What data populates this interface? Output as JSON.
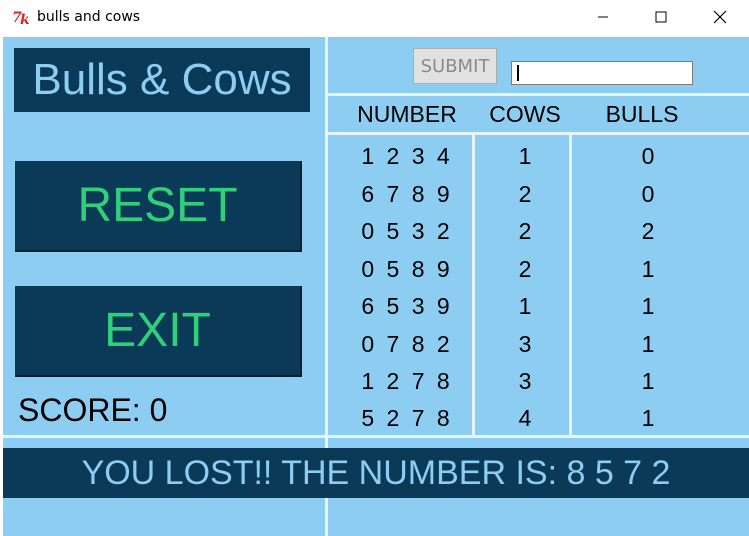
{
  "window": {
    "title": "bulls and cows",
    "icon": "tk-feather-icon",
    "controls": [
      "minimize-icon",
      "maximize-icon",
      "close-icon"
    ]
  },
  "game": {
    "title": "Bulls & Cows",
    "reset_label": "RESET",
    "exit_label": "EXIT",
    "score_label": "SCORE: 0",
    "submit_label": "SUBMIT",
    "guess_input_value": "",
    "status_message": "YOU LOST!! THE NUMBER IS: 8 5 7 2"
  },
  "table": {
    "headers": {
      "number": "NUMBER",
      "cows": "COWS",
      "bulls": "BULLS"
    },
    "rows": [
      {
        "number": "1 2 3 4",
        "cows": "1",
        "bulls": "0"
      },
      {
        "number": "6 7 8 9",
        "cows": "2",
        "bulls": "0"
      },
      {
        "number": "0 5 3 2",
        "cows": "2",
        "bulls": "2"
      },
      {
        "number": "0 5 8 9",
        "cows": "2",
        "bulls": "1"
      },
      {
        "number": "6 5 3 9",
        "cows": "1",
        "bulls": "1"
      },
      {
        "number": "0 7 8 2",
        "cows": "3",
        "bulls": "1"
      },
      {
        "number": "1 2 7 8",
        "cows": "3",
        "bulls": "1"
      },
      {
        "number": "5 2 7 8",
        "cows": "4",
        "bulls": "1"
      }
    ]
  },
  "colors": {
    "background": "#8ecdf2",
    "panel_dark": "#0a3a57",
    "button_text": "#2ed07a",
    "divider": "#e8f4fb"
  }
}
